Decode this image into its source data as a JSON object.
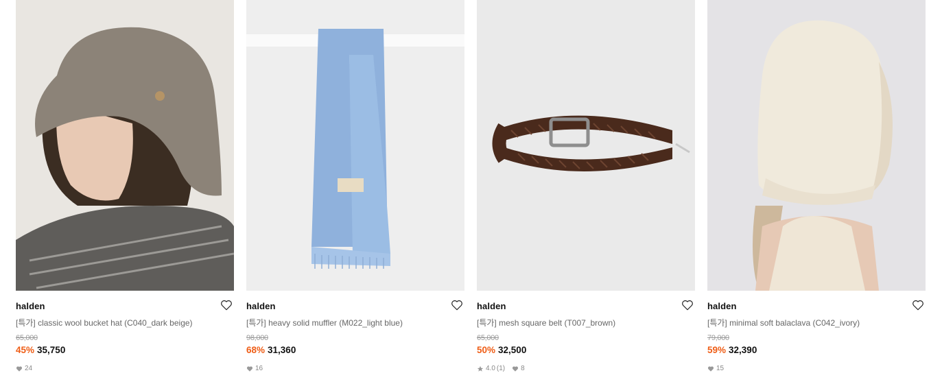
{
  "products": [
    {
      "brand": "halden",
      "title": "[특가] classic wool bucket hat (C040_dark beige)",
      "original_price": "65,000",
      "discount": "45%",
      "sale_price": "35,750",
      "likes": "24",
      "image": "wool-bucket-hat-photo"
    },
    {
      "brand": "halden",
      "title": "[특가] heavy solid muffler (M022_light blue)",
      "original_price": "98,000",
      "discount": "68%",
      "sale_price": "31,360",
      "likes": "16",
      "image": "light-blue-muffler-photo"
    },
    {
      "brand": "halden",
      "title": "[특가] mesh square belt (T007_brown)",
      "original_price": "65,000",
      "discount": "50%",
      "sale_price": "32,500",
      "rating": "4.0",
      "review_count": "(1)",
      "likes": "8",
      "image": "brown-mesh-belt-photo"
    },
    {
      "brand": "halden",
      "title": "[특가] minimal soft balaclava (C042_ivory)",
      "original_price": "79,000",
      "discount": "59%",
      "sale_price": "32,390",
      "likes": "15",
      "image": "ivory-balaclava-photo"
    }
  ],
  "colors": {
    "discount": "#ef5d16",
    "muted": "#888888"
  }
}
